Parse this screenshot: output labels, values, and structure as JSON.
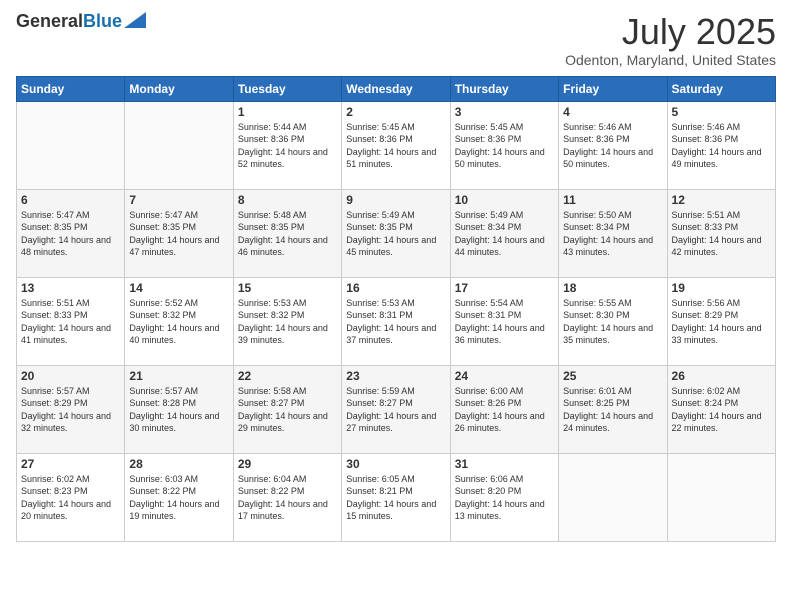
{
  "logo": {
    "general": "General",
    "blue": "Blue"
  },
  "header": {
    "title": "July 2025",
    "subtitle": "Odenton, Maryland, United States"
  },
  "days_of_week": [
    "Sunday",
    "Monday",
    "Tuesday",
    "Wednesday",
    "Thursday",
    "Friday",
    "Saturday"
  ],
  "weeks": [
    [
      {
        "day": "",
        "sunrise": "",
        "sunset": "",
        "daylight": ""
      },
      {
        "day": "",
        "sunrise": "",
        "sunset": "",
        "daylight": ""
      },
      {
        "day": "1",
        "sunrise": "Sunrise: 5:44 AM",
        "sunset": "Sunset: 8:36 PM",
        "daylight": "Daylight: 14 hours and 52 minutes."
      },
      {
        "day": "2",
        "sunrise": "Sunrise: 5:45 AM",
        "sunset": "Sunset: 8:36 PM",
        "daylight": "Daylight: 14 hours and 51 minutes."
      },
      {
        "day": "3",
        "sunrise": "Sunrise: 5:45 AM",
        "sunset": "Sunset: 8:36 PM",
        "daylight": "Daylight: 14 hours and 50 minutes."
      },
      {
        "day": "4",
        "sunrise": "Sunrise: 5:46 AM",
        "sunset": "Sunset: 8:36 PM",
        "daylight": "Daylight: 14 hours and 50 minutes."
      },
      {
        "day": "5",
        "sunrise": "Sunrise: 5:46 AM",
        "sunset": "Sunset: 8:36 PM",
        "daylight": "Daylight: 14 hours and 49 minutes."
      }
    ],
    [
      {
        "day": "6",
        "sunrise": "Sunrise: 5:47 AM",
        "sunset": "Sunset: 8:35 PM",
        "daylight": "Daylight: 14 hours and 48 minutes."
      },
      {
        "day": "7",
        "sunrise": "Sunrise: 5:47 AM",
        "sunset": "Sunset: 8:35 PM",
        "daylight": "Daylight: 14 hours and 47 minutes."
      },
      {
        "day": "8",
        "sunrise": "Sunrise: 5:48 AM",
        "sunset": "Sunset: 8:35 PM",
        "daylight": "Daylight: 14 hours and 46 minutes."
      },
      {
        "day": "9",
        "sunrise": "Sunrise: 5:49 AM",
        "sunset": "Sunset: 8:35 PM",
        "daylight": "Daylight: 14 hours and 45 minutes."
      },
      {
        "day": "10",
        "sunrise": "Sunrise: 5:49 AM",
        "sunset": "Sunset: 8:34 PM",
        "daylight": "Daylight: 14 hours and 44 minutes."
      },
      {
        "day": "11",
        "sunrise": "Sunrise: 5:50 AM",
        "sunset": "Sunset: 8:34 PM",
        "daylight": "Daylight: 14 hours and 43 minutes."
      },
      {
        "day": "12",
        "sunrise": "Sunrise: 5:51 AM",
        "sunset": "Sunset: 8:33 PM",
        "daylight": "Daylight: 14 hours and 42 minutes."
      }
    ],
    [
      {
        "day": "13",
        "sunrise": "Sunrise: 5:51 AM",
        "sunset": "Sunset: 8:33 PM",
        "daylight": "Daylight: 14 hours and 41 minutes."
      },
      {
        "day": "14",
        "sunrise": "Sunrise: 5:52 AM",
        "sunset": "Sunset: 8:32 PM",
        "daylight": "Daylight: 14 hours and 40 minutes."
      },
      {
        "day": "15",
        "sunrise": "Sunrise: 5:53 AM",
        "sunset": "Sunset: 8:32 PM",
        "daylight": "Daylight: 14 hours and 39 minutes."
      },
      {
        "day": "16",
        "sunrise": "Sunrise: 5:53 AM",
        "sunset": "Sunset: 8:31 PM",
        "daylight": "Daylight: 14 hours and 37 minutes."
      },
      {
        "day": "17",
        "sunrise": "Sunrise: 5:54 AM",
        "sunset": "Sunset: 8:31 PM",
        "daylight": "Daylight: 14 hours and 36 minutes."
      },
      {
        "day": "18",
        "sunrise": "Sunrise: 5:55 AM",
        "sunset": "Sunset: 8:30 PM",
        "daylight": "Daylight: 14 hours and 35 minutes."
      },
      {
        "day": "19",
        "sunrise": "Sunrise: 5:56 AM",
        "sunset": "Sunset: 8:29 PM",
        "daylight": "Daylight: 14 hours and 33 minutes."
      }
    ],
    [
      {
        "day": "20",
        "sunrise": "Sunrise: 5:57 AM",
        "sunset": "Sunset: 8:29 PM",
        "daylight": "Daylight: 14 hours and 32 minutes."
      },
      {
        "day": "21",
        "sunrise": "Sunrise: 5:57 AM",
        "sunset": "Sunset: 8:28 PM",
        "daylight": "Daylight: 14 hours and 30 minutes."
      },
      {
        "day": "22",
        "sunrise": "Sunrise: 5:58 AM",
        "sunset": "Sunset: 8:27 PM",
        "daylight": "Daylight: 14 hours and 29 minutes."
      },
      {
        "day": "23",
        "sunrise": "Sunrise: 5:59 AM",
        "sunset": "Sunset: 8:27 PM",
        "daylight": "Daylight: 14 hours and 27 minutes."
      },
      {
        "day": "24",
        "sunrise": "Sunrise: 6:00 AM",
        "sunset": "Sunset: 8:26 PM",
        "daylight": "Daylight: 14 hours and 26 minutes."
      },
      {
        "day": "25",
        "sunrise": "Sunrise: 6:01 AM",
        "sunset": "Sunset: 8:25 PM",
        "daylight": "Daylight: 14 hours and 24 minutes."
      },
      {
        "day": "26",
        "sunrise": "Sunrise: 6:02 AM",
        "sunset": "Sunset: 8:24 PM",
        "daylight": "Daylight: 14 hours and 22 minutes."
      }
    ],
    [
      {
        "day": "27",
        "sunrise": "Sunrise: 6:02 AM",
        "sunset": "Sunset: 8:23 PM",
        "daylight": "Daylight: 14 hours and 20 minutes."
      },
      {
        "day": "28",
        "sunrise": "Sunrise: 6:03 AM",
        "sunset": "Sunset: 8:22 PM",
        "daylight": "Daylight: 14 hours and 19 minutes."
      },
      {
        "day": "29",
        "sunrise": "Sunrise: 6:04 AM",
        "sunset": "Sunset: 8:22 PM",
        "daylight": "Daylight: 14 hours and 17 minutes."
      },
      {
        "day": "30",
        "sunrise": "Sunrise: 6:05 AM",
        "sunset": "Sunset: 8:21 PM",
        "daylight": "Daylight: 14 hours and 15 minutes."
      },
      {
        "day": "31",
        "sunrise": "Sunrise: 6:06 AM",
        "sunset": "Sunset: 8:20 PM",
        "daylight": "Daylight: 14 hours and 13 minutes."
      },
      {
        "day": "",
        "sunrise": "",
        "sunset": "",
        "daylight": ""
      },
      {
        "day": "",
        "sunrise": "",
        "sunset": "",
        "daylight": ""
      }
    ]
  ]
}
